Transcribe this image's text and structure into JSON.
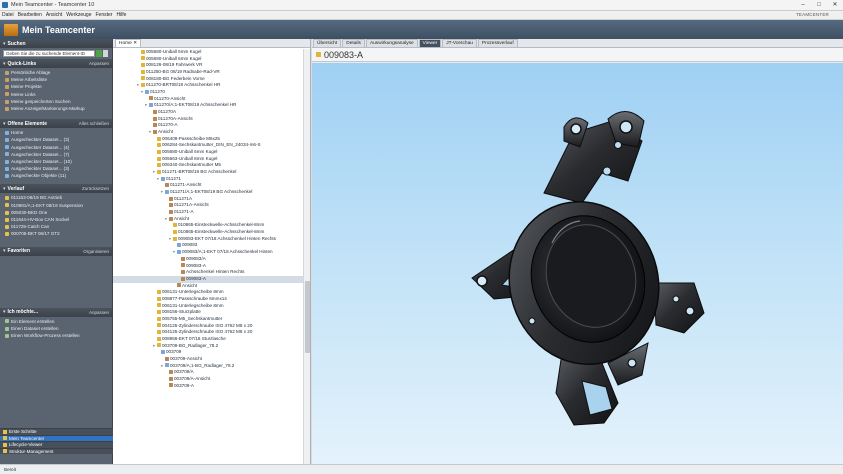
{
  "window": {
    "title": "Mein Teamcenter - Teamcenter 10",
    "brand": "TEAMCENTER"
  },
  "menu": [
    "Datei",
    "Bearbeiten",
    "Ansicht",
    "Werkzeuge",
    "Fenster",
    "Hilfe"
  ],
  "header": {
    "title": "Mein Teamcenter"
  },
  "left": {
    "search": {
      "title": "Suchen",
      "placeholder": "Geben Sie die zu suchende Element-ID"
    },
    "quicklinks": {
      "title": "Quick-Links",
      "action": "Anpassen",
      "items": [
        "Persönliche Ablage",
        "Meine Arbeitsliste",
        "Meine Projekte",
        "Meine Links",
        "Meine gespeicherten Suchen",
        "Meine Anzeige/Markierungs-Markup"
      ]
    },
    "open": {
      "title": "Offene Elemente",
      "action": "Alles schließen",
      "items": [
        "Home",
        "Ausgecheckter Dataset... (3)",
        "Ausgecheckter Dataset... (4)",
        "Ausgecheckter Dataset... (7)",
        "Ausgecheckter Dataset... (10)",
        "Ausgecheckter Dataset... (3)",
        "Ausgecheckte Objekte (11)"
      ]
    },
    "history": {
      "title": "Verlauf",
      "action": "Zurücksetzen",
      "items": [
        "011163-08/19 BG Antrieb",
        "010981/A;1-EKT 08/19 Suspension",
        "005030-BKD One",
        "011644-HV-Box CAN Sockel",
        "011725-Catch Can",
        "000705-BKT 06/17 GT2"
      ]
    },
    "favorites": {
      "title": "Favoriten",
      "action": "Organisieren"
    },
    "iwant": {
      "title": "Ich möchte...",
      "action": "Anpassen",
      "items": [
        "Ein Element erstellen",
        "Einen Dataset erstellen",
        "Einen Workflow-Prozess erstellen"
      ]
    },
    "bottom": [
      "Erste Schritte",
      "Mein Teamcenter",
      "Lifecycle-Viewer",
      "Struktur-Management"
    ]
  },
  "tree": {
    "tab": "Home",
    "rows": [
      {
        "indent": 6,
        "tw": "",
        "icon": "part",
        "label": "005680-Uniball 6mm Kugel"
      },
      {
        "indent": 6,
        "tw": "",
        "icon": "part",
        "label": "005680-Uniball 6mm Kugel"
      },
      {
        "indent": 6,
        "tw": "",
        "icon": "part",
        "label": "008126-08/19 Fahrwerk VR"
      },
      {
        "indent": 6,
        "tw": "",
        "icon": "part",
        "label": "011250-BG 08/19 Radnabe-Rad-VR"
      },
      {
        "indent": 6,
        "tw": "",
        "icon": "part",
        "label": "008180-BG Federbein Vorne"
      },
      {
        "indent": 6,
        "tw": "▾",
        "icon": "part",
        "label": "011270-BRT08/19 Achsschenkel HR"
      },
      {
        "indent": 7,
        "tw": "▾",
        "icon": "rev",
        "label": "011270"
      },
      {
        "indent": 8,
        "tw": "",
        "icon": "ds",
        "label": "011270-Ansicht"
      },
      {
        "indent": 8,
        "tw": "▾",
        "icon": "rev",
        "label": "011270/A;1-EKT08/19 Achsschenkel HR"
      },
      {
        "indent": 9,
        "tw": "",
        "icon": "ds",
        "label": "011270A"
      },
      {
        "indent": 9,
        "tw": "",
        "icon": "ds",
        "label": "011270A-Ansicht"
      },
      {
        "indent": 9,
        "tw": "",
        "icon": "ds",
        "label": "011270-A"
      },
      {
        "indent": 9,
        "tw": "▾",
        "icon": "ds",
        "label": "Ansicht"
      },
      {
        "indent": 10,
        "tw": "",
        "icon": "part",
        "label": "006409-Passscheibe M6x25"
      },
      {
        "indent": 10,
        "tw": "",
        "icon": "part",
        "label": "006284-Sechskantmutter_DIN_EN_24034-m6-S"
      },
      {
        "indent": 10,
        "tw": "",
        "icon": "part",
        "label": "005680-Uniball 6mm Kugel"
      },
      {
        "indent": 10,
        "tw": "",
        "icon": "part",
        "label": "005663-Uniball 8mm Kugel"
      },
      {
        "indent": 10,
        "tw": "",
        "icon": "part",
        "label": "006340-Sechskantmutter M5"
      },
      {
        "indent": 10,
        "tw": "▾",
        "icon": "part",
        "label": "011271-BRT08/19 BG Achsschenkel"
      },
      {
        "indent": 11,
        "tw": "▾",
        "icon": "rev",
        "label": "011271"
      },
      {
        "indent": 12,
        "tw": "",
        "icon": "ds",
        "label": "011271-Ansicht"
      },
      {
        "indent": 12,
        "tw": "▾",
        "icon": "rev",
        "label": "011271/A;1-EKT08/19 BG Achsschenkel"
      },
      {
        "indent": 13,
        "tw": "",
        "icon": "ds",
        "label": "011271A"
      },
      {
        "indent": 13,
        "tw": "",
        "icon": "ds",
        "label": "011271A-Ansicht"
      },
      {
        "indent": 13,
        "tw": "",
        "icon": "ds",
        "label": "011271-A"
      },
      {
        "indent": 13,
        "tw": "▾",
        "icon": "ds",
        "label": "Ansicht"
      },
      {
        "indent": 14,
        "tw": "",
        "icon": "part",
        "label": "010865-Einsteckwelle-Achsschenkel-8mm"
      },
      {
        "indent": 14,
        "tw": "",
        "icon": "part",
        "label": "010865-Einsteckwelle-Achsschenkel-8mm"
      },
      {
        "indent": 14,
        "tw": "▾",
        "icon": "part",
        "label": "009083-EKT 07/18 Achsschenkel Hinten Rechts"
      },
      {
        "indent": 15,
        "tw": "",
        "icon": "rev",
        "label": "009083"
      },
      {
        "indent": 15,
        "tw": "▾",
        "icon": "rev",
        "label": "009083/A;1-EKT 07/18 Achsschenkel Hinten"
      },
      {
        "indent": 16,
        "tw": "",
        "icon": "ds",
        "label": "009083/A"
      },
      {
        "indent": 16,
        "tw": "",
        "icon": "ds",
        "label": "009083-A"
      },
      {
        "indent": 16,
        "tw": "",
        "icon": "ds",
        "label": "Achsschenkel Hinten Rechts"
      },
      {
        "indent": 16,
        "tw": "",
        "icon": "ds",
        "label": "009083-A",
        "selected": true
      },
      {
        "indent": 15,
        "tw": "",
        "icon": "ds",
        "label": "Ansicht"
      },
      {
        "indent": 10,
        "tw": "",
        "icon": "part",
        "label": "006131-Unterlegscheibe 8mm"
      },
      {
        "indent": 10,
        "tw": "",
        "icon": "part",
        "label": "008877-Passschraube 6mmx14"
      },
      {
        "indent": 10,
        "tw": "",
        "icon": "part",
        "label": "006131-Unterlegscheibe 8mm"
      },
      {
        "indent": 10,
        "tw": "",
        "icon": "part",
        "label": "008156-Sturzplatte"
      },
      {
        "indent": 10,
        "tw": "",
        "icon": "part",
        "label": "005755-M5_Sechskantmutter"
      },
      {
        "indent": 10,
        "tw": "",
        "icon": "part",
        "label": "004125-Zylinderschraube ISO 4762 M8 x 20"
      },
      {
        "indent": 10,
        "tw": "",
        "icon": "part",
        "label": "004125-Zylinderschraube ISO 4762 M8 x 20"
      },
      {
        "indent": 10,
        "tw": "",
        "icon": "part",
        "label": "008956-EKT 07/18 Sturzlasche"
      },
      {
        "indent": 10,
        "tw": "▾",
        "icon": "part",
        "label": "003709-BG_Radlager_78.2"
      },
      {
        "indent": 11,
        "tw": "",
        "icon": "rev",
        "label": "003709"
      },
      {
        "indent": 12,
        "tw": "",
        "icon": "ds",
        "label": "003709-Ansicht"
      },
      {
        "indent": 12,
        "tw": "▾",
        "icon": "rev",
        "label": "003709/A;1-BG_Radlager_78.2"
      },
      {
        "indent": 13,
        "tw": "",
        "icon": "ds",
        "label": "003709/A"
      },
      {
        "indent": 13,
        "tw": "",
        "icon": "ds",
        "label": "003709/A-Ansicht"
      },
      {
        "indent": 13,
        "tw": "",
        "icon": "ds",
        "label": "003709-A"
      }
    ]
  },
  "viewer": {
    "tabs": [
      "Übersicht",
      "Details",
      "Auswirkungsanalyse",
      "Viewer",
      "JT-Vorschau",
      "Prozessverlauf"
    ],
    "active_tab": 3,
    "title": "009083-A"
  },
  "status": {
    "text": "Bereit"
  },
  "colors": {
    "header": "#4a5c70",
    "nav": "#5a6370",
    "selection": "#2f74c0",
    "viewport_top": "#9fd0f3"
  }
}
